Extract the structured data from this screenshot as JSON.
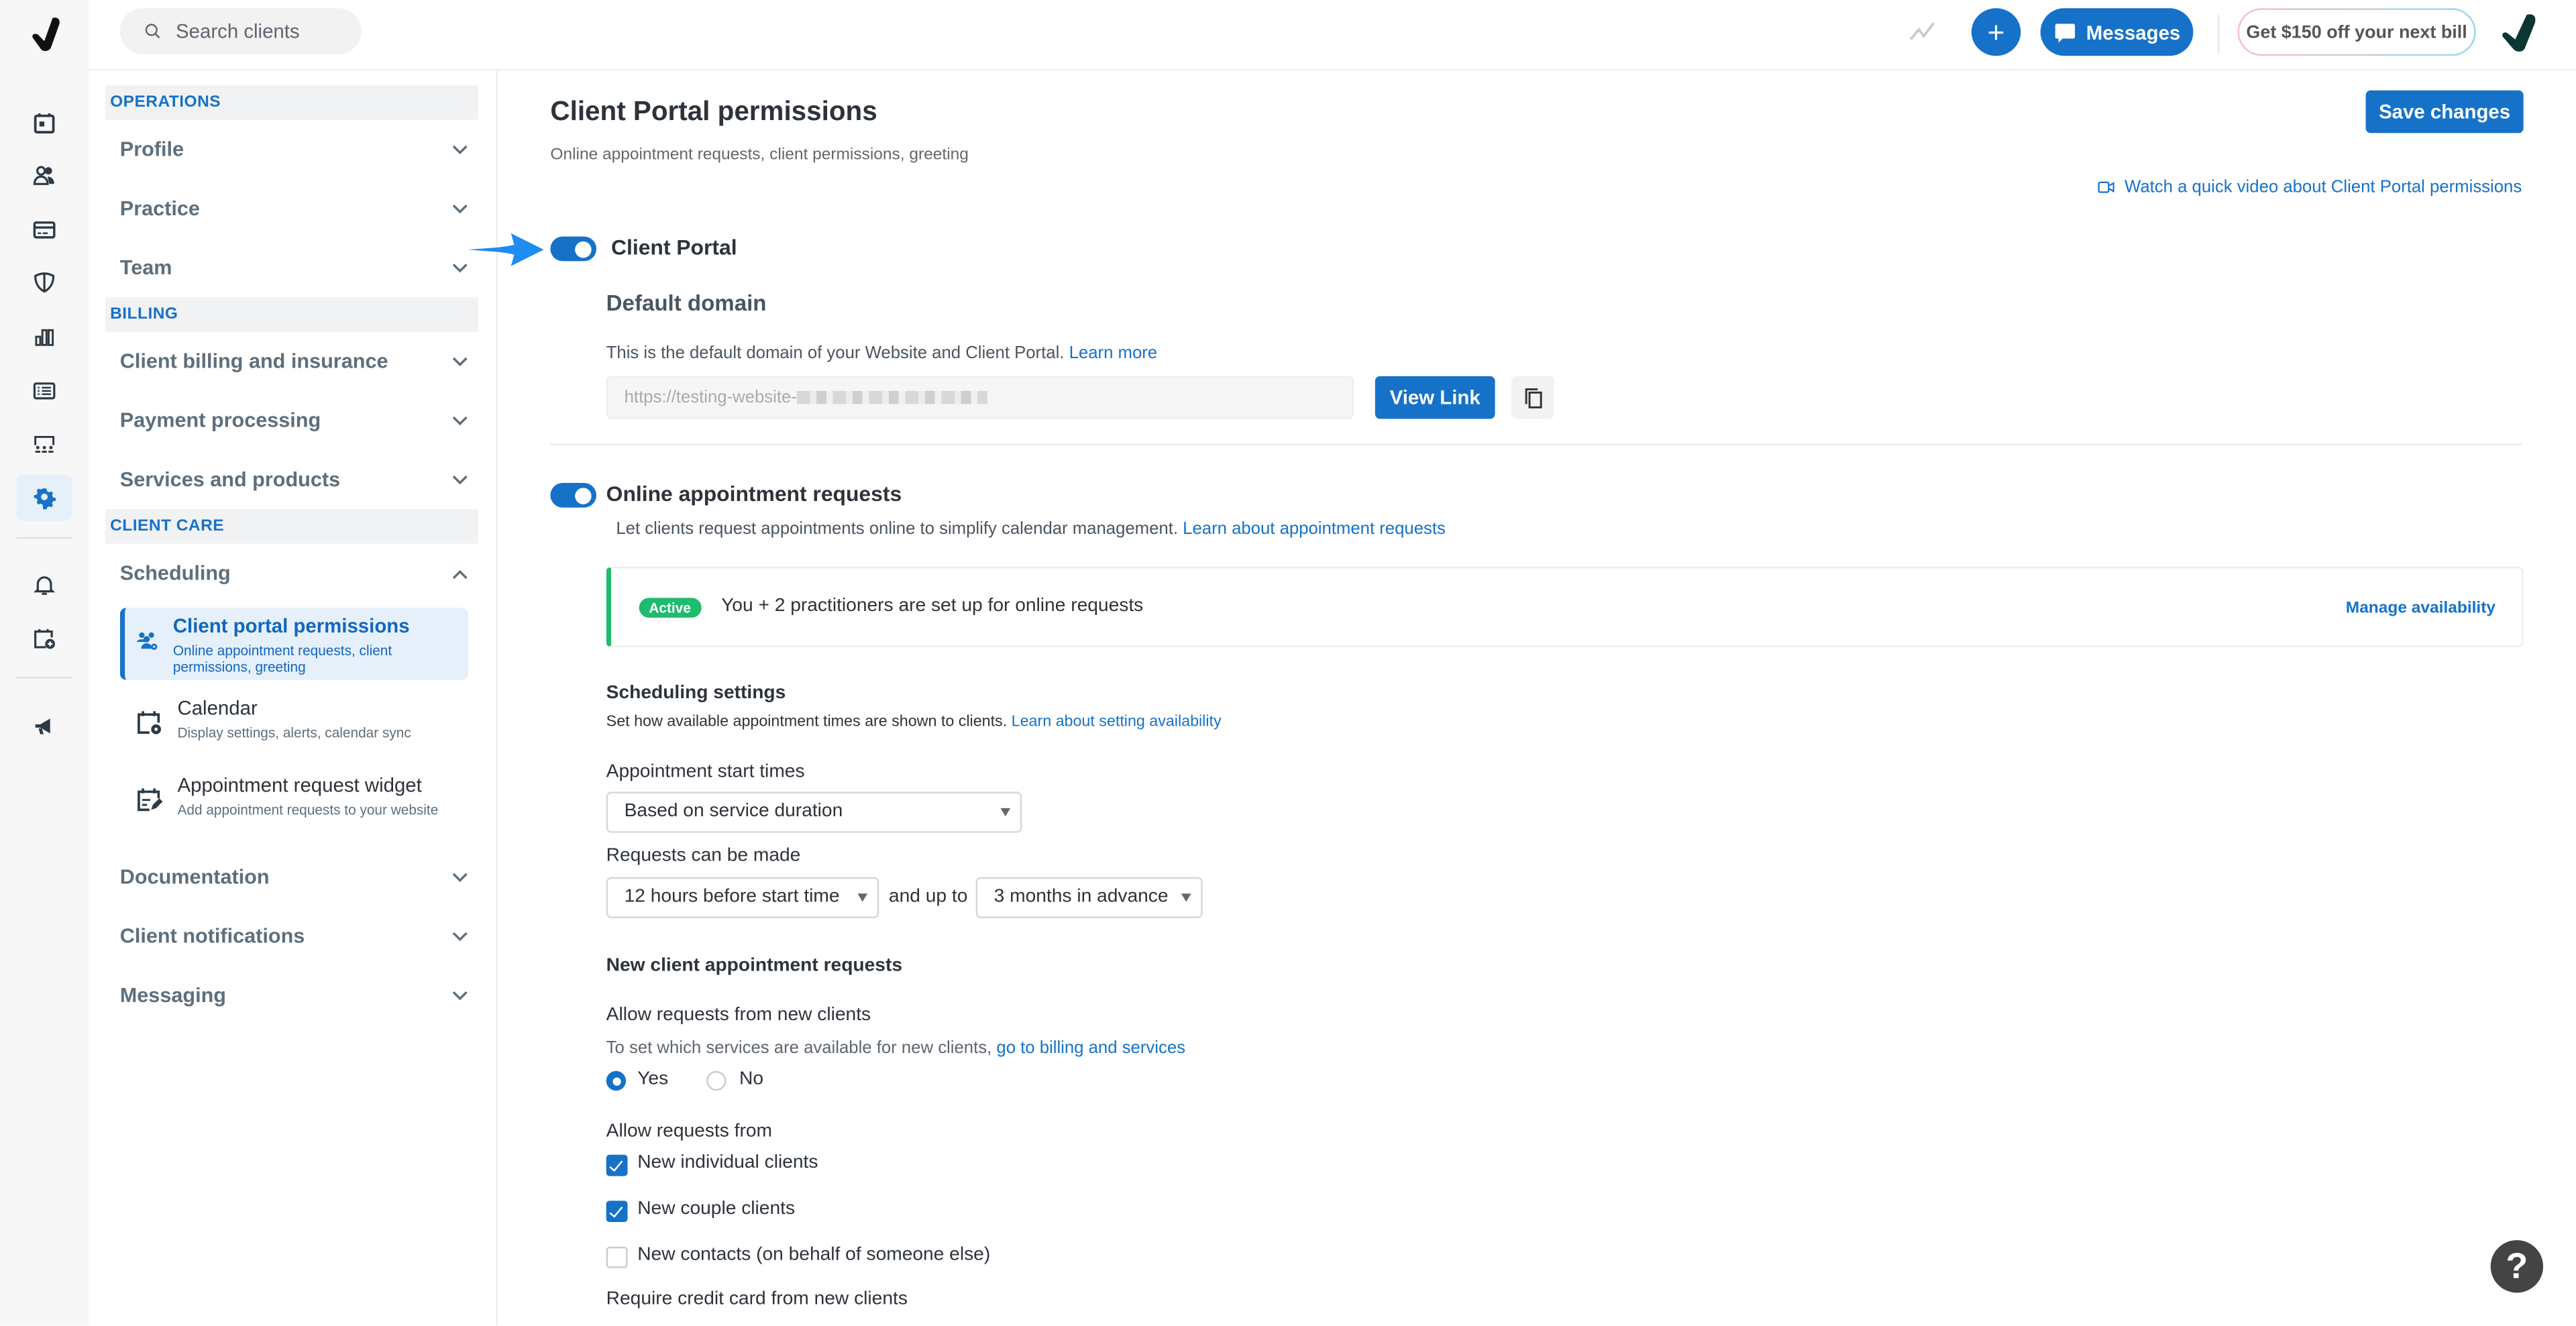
{
  "header": {
    "search_placeholder": "Search clients",
    "plus_label": "+",
    "messages_label": "Messages",
    "promo_label": "Get $150 off your next bill"
  },
  "rail": {
    "icons": [
      "calendar-icon",
      "clients-icon",
      "billing-card-icon",
      "insurance-shield-icon",
      "analytics-icon",
      "list-icon",
      "team-icon",
      "settings-gear-icon",
      "bell-icon",
      "calendar-add-icon",
      "megaphone-icon"
    ],
    "active": "settings-gear-icon"
  },
  "sidebar": {
    "sections": [
      {
        "title": "OPERATIONS",
        "items": [
          "Profile",
          "Practice",
          "Team"
        ]
      },
      {
        "title": "BILLING",
        "items": [
          "Client billing and insurance",
          "Payment processing",
          "Services and products"
        ]
      },
      {
        "title": "CLIENT CARE",
        "items": [
          "Scheduling",
          "Documentation",
          "Client notifications",
          "Messaging"
        ]
      }
    ],
    "scheduling_expanded": true,
    "scheduling_subitems": [
      {
        "title": "Client portal permissions",
        "subtitle": "Online appointment requests, client permissions, greeting",
        "active": true
      },
      {
        "title": "Calendar",
        "subtitle": "Display settings, alerts, calendar sync",
        "active": false
      },
      {
        "title": "Appointment request widget",
        "subtitle": "Add appointment requests to your website",
        "active": false
      }
    ]
  },
  "main": {
    "title": "Client Portal permissions",
    "subtitle": "Online appointment requests, client permissions, greeting",
    "save_label": "Save changes",
    "video_link": "Watch a quick video about Client Portal permissions",
    "client_portal": {
      "label": "Client Portal",
      "enabled": true,
      "default_domain_title": "Default domain",
      "default_domain_desc": "This is the default domain of your Website and Client Portal.",
      "learn_more": "Learn more",
      "url_value": "https://testing-website-",
      "view_link_label": "View Link"
    },
    "online_requests": {
      "label": "Online appointment requests",
      "enabled": true,
      "desc": "Let clients request appointments online to simplify calendar management.",
      "learn_link": "Learn about appointment requests",
      "badge": "Active",
      "status_text": "You + 2 practitioners are set up for online requests",
      "manage_link": "Manage availability"
    },
    "scheduling_settings": {
      "title": "Scheduling settings",
      "desc": "Set how available appointment times are shown to clients.",
      "learn_link": "Learn about setting availability",
      "start_times_label": "Appointment start times",
      "start_times_value": "Based on service duration",
      "requests_label": "Requests can be made",
      "min_notice_value": "12 hours before start time",
      "and_up_to": "and up to",
      "max_advance_value": "3 months in advance"
    },
    "new_client": {
      "title": "New client appointment requests",
      "allow_label": "Allow requests from new clients",
      "allow_desc": "To set which services are available for new clients,",
      "billing_link": "go to billing and services",
      "yes_label": "Yes",
      "no_label": "No",
      "selected": "Yes",
      "allow_from_label": "Allow requests from",
      "checkboxes": [
        {
          "label": "New individual clients",
          "checked": true
        },
        {
          "label": "New couple clients",
          "checked": true
        },
        {
          "label": "New contacts (on behalf of someone else)",
          "checked": false
        }
      ],
      "credit_card_label": "Require credit card from new clients"
    }
  },
  "help_label": "?",
  "colors": {
    "accent": "#1672c8",
    "active_green": "#1fbb6f",
    "annotation_arrow": "#1e8cf0"
  }
}
